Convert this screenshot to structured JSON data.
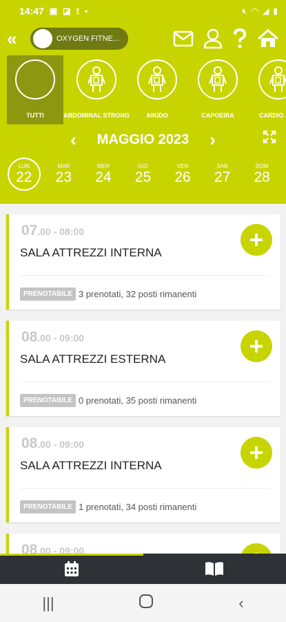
{
  "status_bar": {
    "time": "14:47",
    "notification_icons": [
      "gallery-icon",
      "photo-icon",
      "usb-icon",
      "dot-icon"
    ],
    "system_icons": [
      "mute-icon",
      "wifi-icon",
      "signal-icon",
      "battery-icon"
    ]
  },
  "topbar": {
    "gym_name": "OXYGEN FITNE..."
  },
  "categories": [
    {
      "label": "TUTTI",
      "active": true
    },
    {
      "label": "ABDOMINAL STRONG",
      "active": false
    },
    {
      "label": "AIKIDO",
      "active": false
    },
    {
      "label": "CAPOEIRA",
      "active": false
    },
    {
      "label": "CARDIO JOY",
      "active": false
    }
  ],
  "calendar": {
    "month": "MAGGIO 2023",
    "days": [
      {
        "weekday": "LUN",
        "num": "22",
        "selected": true
      },
      {
        "weekday": "MAR",
        "num": "23"
      },
      {
        "weekday": "MER",
        "num": "24"
      },
      {
        "weekday": "GIO",
        "num": "25"
      },
      {
        "weekday": "VEN",
        "num": "26"
      },
      {
        "weekday": "SAB",
        "num": "27"
      },
      {
        "weekday": "DOM",
        "num": "28"
      }
    ]
  },
  "sessions": [
    {
      "hour": "07",
      "rest": ".00 - 08:00",
      "title": "SALA ATTREZZI INTERNA",
      "badge": "PRENOTABILE",
      "availability": "3 prenotati, 32 posti rimanenti"
    },
    {
      "hour": "08",
      "rest": ".00 - 09:00",
      "title": "SALA ATTREZZI ESTERNA",
      "badge": "PRENOTABILE",
      "availability": "0 prenotati, 35 posti rimanenti"
    },
    {
      "hour": "08",
      "rest": ".00 - 09:00",
      "title": "SALA ATTREZZI INTERNA",
      "badge": "PRENOTABILE",
      "availability": "1 prenotati, 34 posti rimanenti"
    },
    {
      "hour": "08",
      "rest": ".00 - 09:00",
      "title": "",
      "badge": "",
      "availability": ""
    }
  ],
  "colors": {
    "accent": "#c8d400",
    "nav_bg": "#2e3135"
  }
}
